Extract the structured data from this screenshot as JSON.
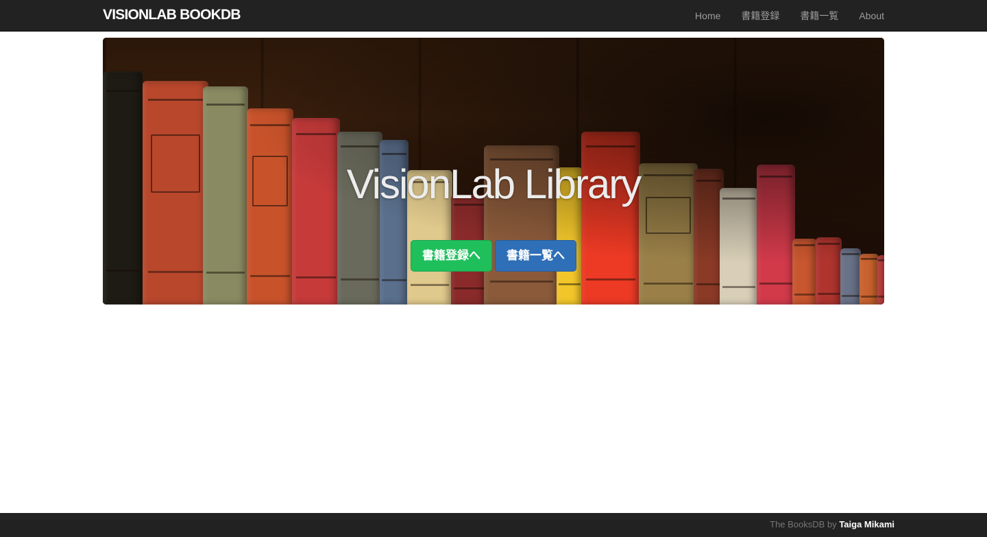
{
  "navbar": {
    "brand": "VISIONLAB BOOKDB",
    "links": [
      "Home",
      "書籍登録",
      "書籍一覧",
      "About"
    ]
  },
  "hero": {
    "title": "VisionLab Library",
    "buttons": {
      "register": "書籍登録へ",
      "list": "書籍一覧へ"
    }
  },
  "footer": {
    "prefix": "The BooksDB",
    "by": "by",
    "author": "Taiga Mikami"
  },
  "colors": {
    "navbar_bg": "#222222",
    "nav_link": "#9d9d9d",
    "success_button": "#1fbf5c",
    "primary_button": "#2f6fb7",
    "footer_bg": "#222222"
  },
  "images": {
    "hero_background": "bookshelf-with-old-books"
  }
}
